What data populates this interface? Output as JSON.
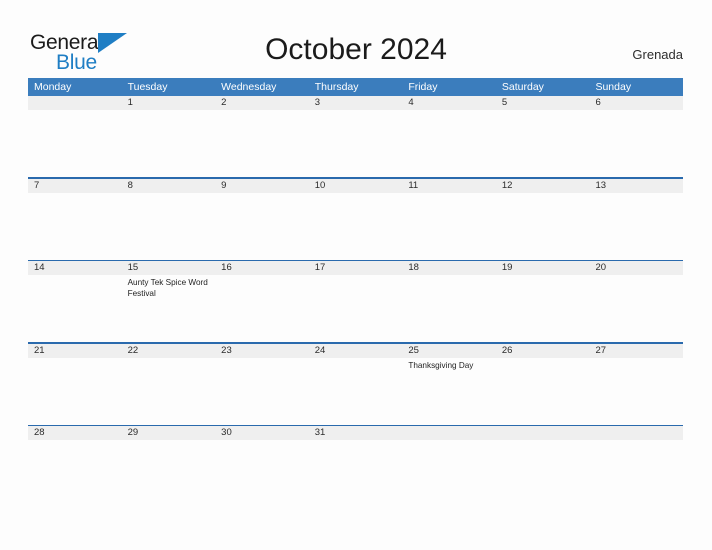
{
  "brand": {
    "name_part1": "General",
    "name_part2": "Blue",
    "accent_color": "#1f7ec4"
  },
  "header": {
    "title": "October 2024",
    "region": "Grenada"
  },
  "calendar": {
    "header_bg": "#3b7dbd",
    "separator_color": "#2a6aad",
    "date_band_bg": "#efefef",
    "weekdays": [
      "Monday",
      "Tuesday",
      "Wednesday",
      "Thursday",
      "Friday",
      "Saturday",
      "Sunday"
    ],
    "weeks": [
      {
        "days": [
          {
            "date": "",
            "events": []
          },
          {
            "date": "1",
            "events": []
          },
          {
            "date": "2",
            "events": []
          },
          {
            "date": "3",
            "events": []
          },
          {
            "date": "4",
            "events": []
          },
          {
            "date": "5",
            "events": []
          },
          {
            "date": "6",
            "events": []
          }
        ]
      },
      {
        "days": [
          {
            "date": "7",
            "events": []
          },
          {
            "date": "8",
            "events": []
          },
          {
            "date": "9",
            "events": []
          },
          {
            "date": "10",
            "events": []
          },
          {
            "date": "11",
            "events": []
          },
          {
            "date": "12",
            "events": []
          },
          {
            "date": "13",
            "events": []
          }
        ]
      },
      {
        "days": [
          {
            "date": "14",
            "events": []
          },
          {
            "date": "15",
            "events": [
              "Aunty Tek Spice Word Festival"
            ]
          },
          {
            "date": "16",
            "events": []
          },
          {
            "date": "17",
            "events": []
          },
          {
            "date": "18",
            "events": []
          },
          {
            "date": "19",
            "events": []
          },
          {
            "date": "20",
            "events": []
          }
        ]
      },
      {
        "days": [
          {
            "date": "21",
            "events": []
          },
          {
            "date": "22",
            "events": []
          },
          {
            "date": "23",
            "events": []
          },
          {
            "date": "24",
            "events": []
          },
          {
            "date": "25",
            "events": [
              "Thanksgiving Day"
            ]
          },
          {
            "date": "26",
            "events": []
          },
          {
            "date": "27",
            "events": []
          }
        ]
      },
      {
        "days": [
          {
            "date": "28",
            "events": []
          },
          {
            "date": "29",
            "events": []
          },
          {
            "date": "30",
            "events": []
          },
          {
            "date": "31",
            "events": []
          },
          {
            "date": "",
            "events": []
          },
          {
            "date": "",
            "events": []
          },
          {
            "date": "",
            "events": []
          }
        ]
      }
    ]
  }
}
